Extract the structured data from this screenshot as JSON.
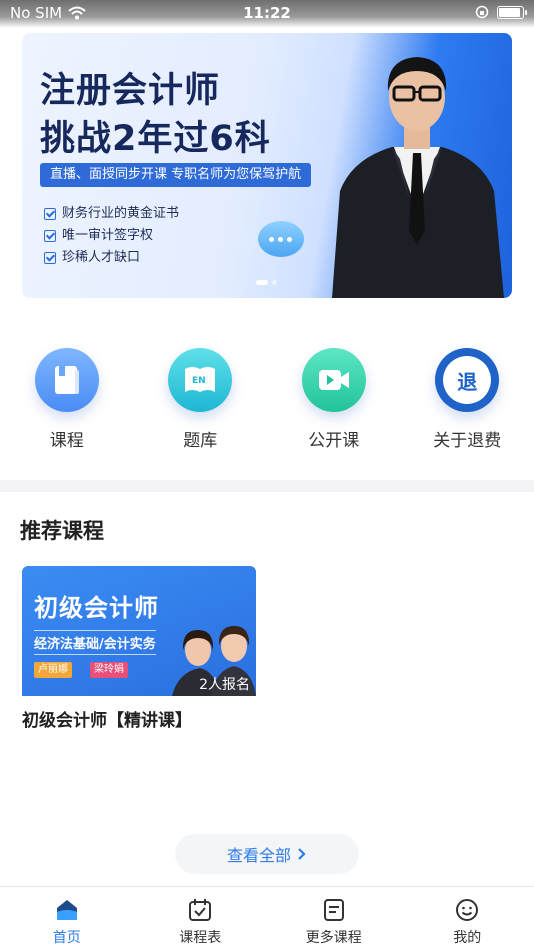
{
  "status_bar": {
    "carrier": "No SIM",
    "time": "11:22"
  },
  "banner": {
    "title_line1": "注册会计师",
    "title_line2": "挑战2年过6科",
    "subtitle": "直播、面授同步开课  专职名师为您保驾护航",
    "features": [
      "财务行业的黄金证书",
      "唯一审计签字权",
      "珍稀人才缺口"
    ]
  },
  "quick_nav": [
    {
      "label": "课程",
      "icon": "book-icon"
    },
    {
      "label": "题库",
      "icon": "question-bank-icon"
    },
    {
      "label": "公开课",
      "icon": "video-icon"
    },
    {
      "label": "关于退费",
      "icon": "refund-icon",
      "icon_text": "退"
    }
  ],
  "recommended": {
    "title": "推荐课程",
    "courses": [
      {
        "thumb_title": "初级会计师",
        "thumb_subtitle": "经济法基础/会计实务",
        "teachers": [
          "卢丽娜",
          "梁玲娟"
        ],
        "enrollment": "2人报名",
        "name": "初级会计师【精讲课】"
      }
    ]
  },
  "view_all": {
    "label": "查看全部"
  },
  "tab_bar": [
    {
      "label": "首页",
      "icon": "home-icon",
      "active": true
    },
    {
      "label": "课程表",
      "icon": "calendar-icon",
      "active": false
    },
    {
      "label": "更多课程",
      "icon": "courses-icon",
      "active": false
    },
    {
      "label": "我的",
      "icon": "profile-icon",
      "active": false
    }
  ],
  "colors": {
    "accent": "#2f7be9",
    "banner_title": "#17285c"
  }
}
